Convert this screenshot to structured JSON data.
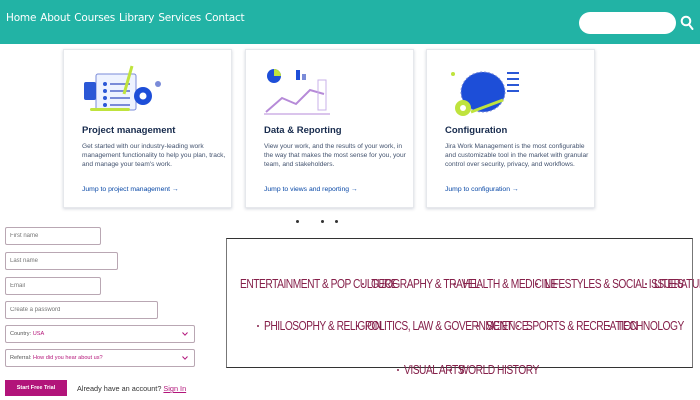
{
  "nav": {
    "links": [
      "Home",
      "About",
      "Courses",
      "Library",
      "Services",
      "Contact"
    ],
    "search_placeholder": ""
  },
  "cards": [
    {
      "title": "Project management",
      "description": "Get started with our industry-leading work management functionality to help you plan, track, and manage your team's work.",
      "link": "Jump to project management →"
    },
    {
      "title": "Data & Reporting",
      "description": "View your work, and the results of your work, in the way that makes the most sense for you, your team, and stakeholders.",
      "link": "Jump to views and reporting →"
    },
    {
      "title": "Configuration",
      "description": "Jira Work Management is the most configurable and customizable tool in the market with granular control over security, privacy, and workflows.",
      "link": "Jump to configuration →"
    }
  ],
  "form": {
    "first_name_placeholder": "First name",
    "last_name_placeholder": "Last name",
    "email_placeholder": "Email",
    "password_placeholder": "Create a password",
    "country_label": "Country:",
    "country_value": "USA",
    "referral_label": "Referral:",
    "referral_value": "How did you hear about us?",
    "submit_label": "Start Free Trial",
    "account_prompt": "Already have an account?",
    "signin_label": "Sign In"
  },
  "categories": {
    "row1": [
      "ENTERTAINMENT & POP CULTURE",
      "GEOGRAPHY & TRAVEL",
      "HEALTH & MEDICINE",
      "LIFESTYLES & SOCIAL ISSUES",
      "LITERATURE"
    ],
    "row2": [
      "PHILOSOPHY & RELIGION",
      "POLITICS, LAW & GOVERNMENT",
      "SCIENCE",
      "SPORTS & RECREATION",
      "TECHNOLOGY"
    ],
    "row3": [
      "VISUAL ARTS",
      "WORLD HISTORY"
    ]
  },
  "colors": {
    "topbar": "#22b3a5",
    "accent": "#b2147a",
    "category_text": "#85204a",
    "link": "#0747a6"
  }
}
